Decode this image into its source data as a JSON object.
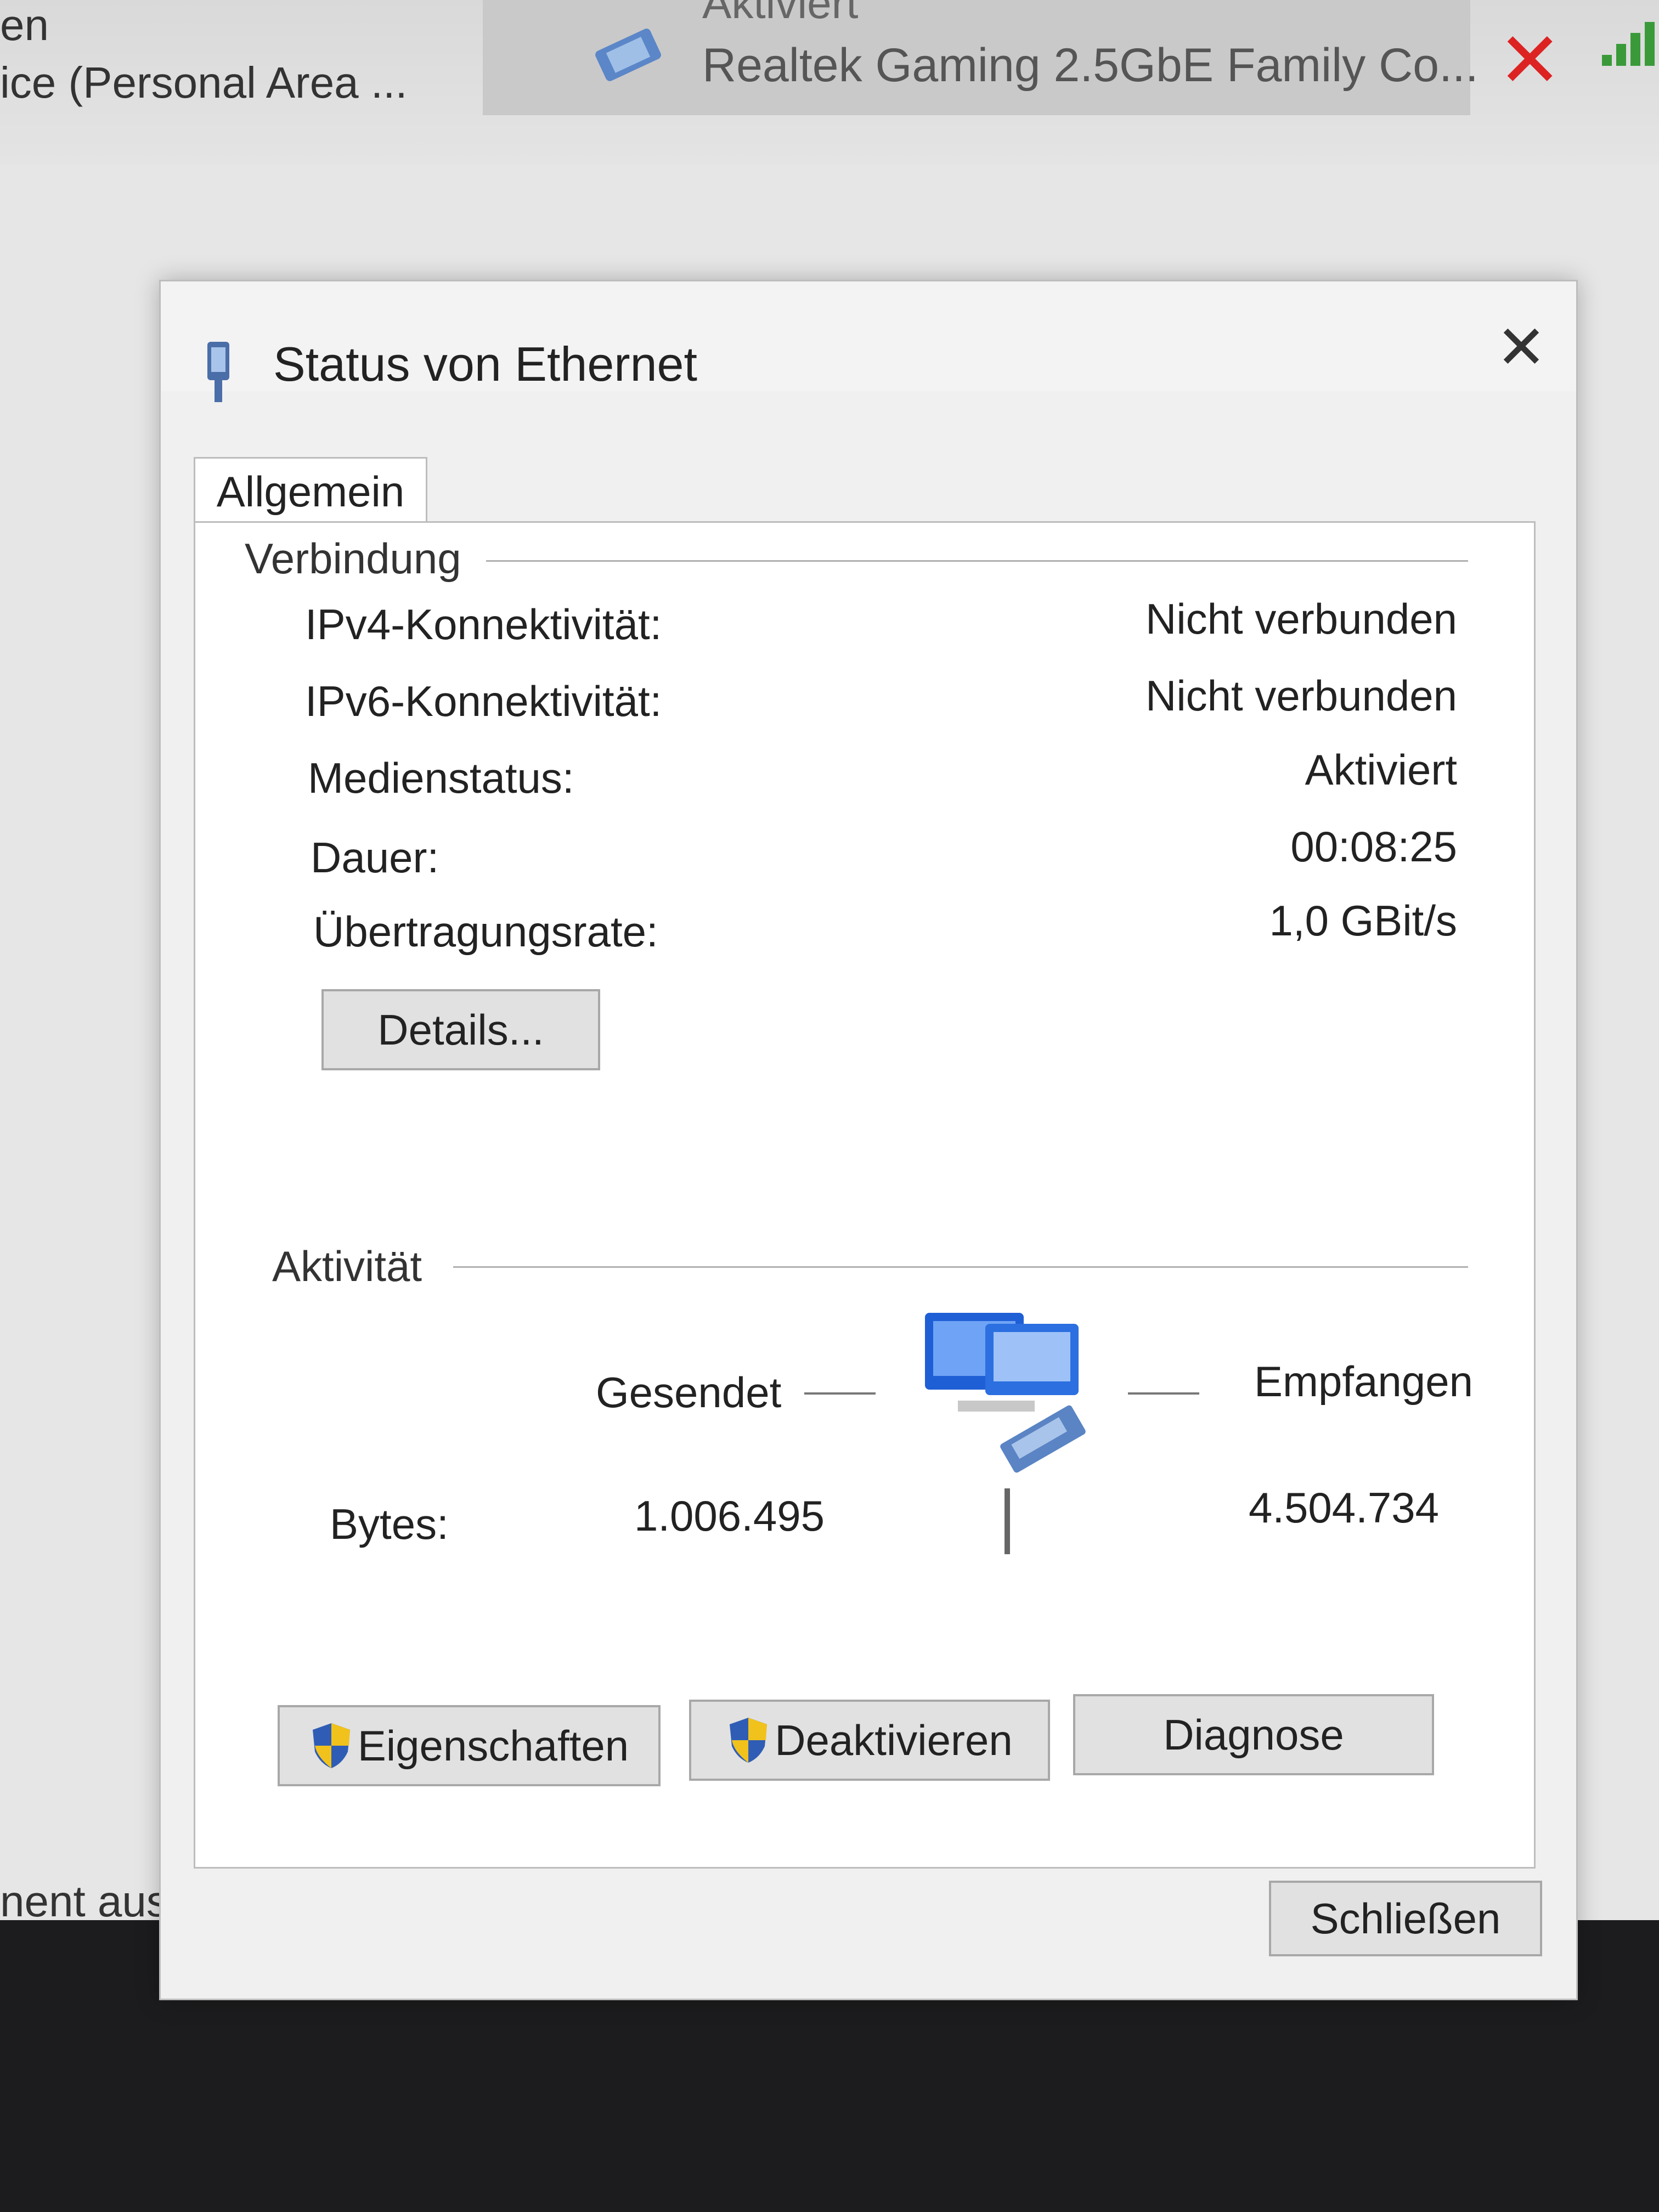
{
  "background": {
    "line1": "en",
    "line2": "ice (Personal Area ...",
    "adapter_status": "Aktiviert",
    "adapter_name": "Realtek Gaming 2.5GbE Family Co...",
    "lower_text": "nent ausgev"
  },
  "dialog": {
    "title": "Status von Ethernet",
    "tab": "Allgemein",
    "connection": {
      "group_title": "Verbindung",
      "rows": [
        {
          "label": "IPv4-Konnektivität:",
          "value": "Nicht verbunden"
        },
        {
          "label": "IPv6-Konnektivität:",
          "value": "Nicht verbunden"
        },
        {
          "label": "Medienstatus:",
          "value": "Aktiviert"
        },
        {
          "label": "Dauer:",
          "value": "00:08:25"
        },
        {
          "label": "Übertragungsrate:",
          "value": "1,0 GBit/s"
        }
      ],
      "details_button": "Details..."
    },
    "activity": {
      "group_title": "Aktivität",
      "sent_label": "Gesendet",
      "received_label": "Empfangen",
      "bytes_label": "Bytes:",
      "bytes_sent": "1.006.495",
      "bytes_received": "4.504.734"
    },
    "buttons": {
      "properties": "Eigenschaften",
      "disable": "Deaktivieren",
      "diagnose": "Diagnose",
      "close": "Schließen"
    }
  },
  "colors": {
    "dialog_bg": "#f0f0f0",
    "panel_bg": "#ffffff",
    "button_bg": "#e1e1e1",
    "error_x": "#dd2222"
  }
}
